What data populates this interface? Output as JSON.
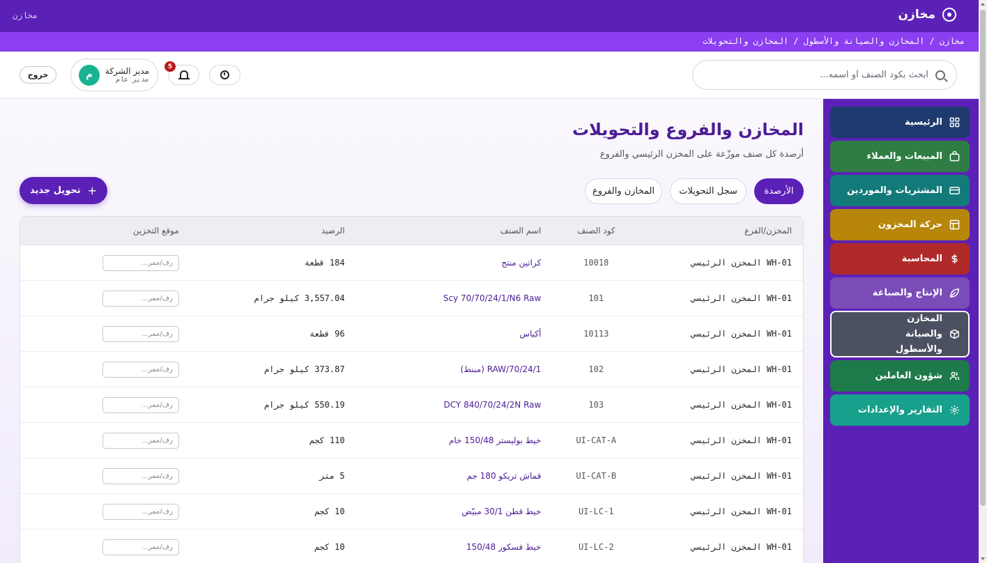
{
  "app": {
    "brand_name": "مخازن",
    "top_left_label": "مخازن"
  },
  "breadcrumb": "مخازن / المخازن والصيانة والأسطول / المخازن والتحويلات",
  "header": {
    "search_placeholder": "ابحث بكود الصنف أو اسمه...",
    "notification_count": "5",
    "user_name": "مدير الشركة",
    "user_role": "مدير عام",
    "avatar_initial": "م",
    "logout_label": "خروج"
  },
  "page": {
    "title": "المخازن والفروع والتحويلات",
    "subtitle": "أرصدة كل صنف موزّعة على المخزن الرئيسي والفروع",
    "tabs": [
      "الأرصدة",
      "سجل التحويلات",
      "المخازن والفروع"
    ],
    "new_transfer_label": "تحويل جديد"
  },
  "table": {
    "columns": [
      "المخزن/الفرع",
      "كود الصنف",
      "اسم الصنف",
      "الرصيد",
      "موقع التخزين"
    ],
    "location_placeholder": "رف/ممر...",
    "rows": [
      {
        "branch": "WH-01 المخزن الرئيسي",
        "code": "10018",
        "name": "كراتين منتج",
        "qty": "184 قطعة"
      },
      {
        "branch": "WH-01 المخزن الرئيسي",
        "code": "101",
        "name": "Scy 70/70/24/1/N6 Raw",
        "qty": "3,557.04 كيلو جرام"
      },
      {
        "branch": "WH-01 المخزن الرئيسي",
        "code": "10113",
        "name": "أكياس",
        "qty": "96 قطعة"
      },
      {
        "branch": "WH-01 المخزن الرئيسي",
        "code": "102",
        "name": "RAW/70/24/1 (مبنط)",
        "qty": "373.87 كيلو جرام"
      },
      {
        "branch": "WH-01 المخزن الرئيسي",
        "code": "103",
        "name": "DCY 840/70/24/2N Raw",
        "qty": "550.19 كيلو جرام"
      },
      {
        "branch": "WH-01 المخزن الرئيسي",
        "code": "UI-CAT-A",
        "name": "خيط بوليستر 150/48 خام",
        "qty": "110 كجم"
      },
      {
        "branch": "WH-01 المخزن الرئيسي",
        "code": "UI-CAT-B",
        "name": "قماش تريكو 180 جم",
        "qty": "5 متر"
      },
      {
        "branch": "WH-01 المخزن الرئيسي",
        "code": "UI-LC-1",
        "name": "خيط قطن 30/1 مبيّض",
        "qty": "10 كجم"
      },
      {
        "branch": "WH-01 المخزن الرئيسي",
        "code": "UI-LC-2",
        "name": "خيط فسكوز 150/48",
        "qty": "10 كجم"
      }
    ]
  },
  "sidebar": {
    "items": [
      {
        "label": "الرئيسية",
        "icon": "grid-icon",
        "color": "#1e3a6e"
      },
      {
        "label": "المبيعات والعملاء",
        "icon": "bag-icon",
        "color": "#2f7d44"
      },
      {
        "label": "المشتريات والموردين",
        "icon": "card-icon",
        "color": "#137a7a"
      },
      {
        "label": "حركة المخزون",
        "icon": "table-icon",
        "color": "#b7860b"
      },
      {
        "label": "المحاسبة",
        "icon": "dollar-icon",
        "color": "#b02a2a"
      },
      {
        "label": "الإنتاج والصباغة",
        "icon": "leaf-icon",
        "color": "#7a4cb8"
      },
      {
        "label": "المخازن والصيانة والأسطول",
        "icon": "box-icon",
        "color": "#4b5160",
        "active": true
      },
      {
        "label": "شؤون العاملين",
        "icon": "users-icon",
        "color": "#1e7a4a"
      },
      {
        "label": "التقارير والإعدادات",
        "icon": "gear-icon",
        "color": "#17a08c"
      }
    ]
  }
}
